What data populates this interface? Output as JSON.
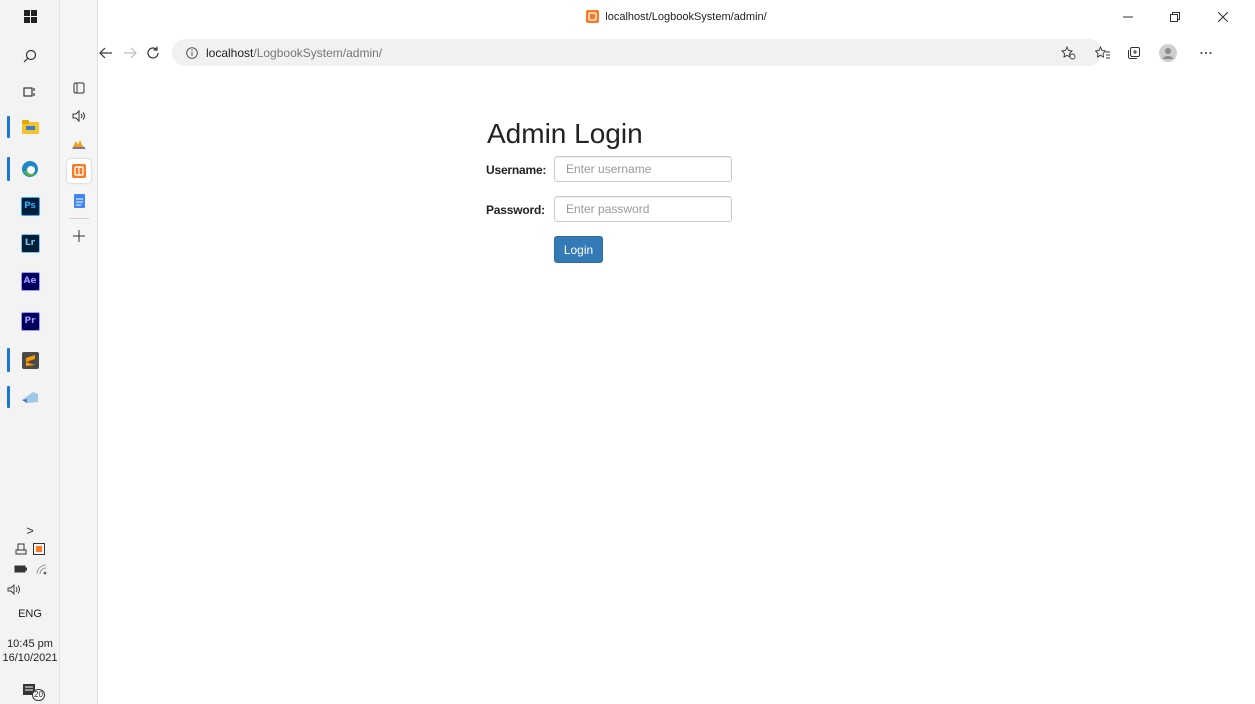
{
  "window": {
    "title": "localhost/LogbookSystem/admin/"
  },
  "address_bar": {
    "info_icon": "info-icon",
    "host": "localhost",
    "path": "/LogbookSystem/admin/"
  },
  "taskbar": {
    "apps": [
      {
        "name": "windows-start",
        "glyph": ""
      },
      {
        "name": "search",
        "glyph": ""
      },
      {
        "name": "task-view",
        "glyph": ""
      },
      {
        "name": "file-explorer",
        "glyph": ""
      },
      {
        "name": "microsoft-edge",
        "glyph": ""
      },
      {
        "name": "photoshop",
        "glyph": "Ps"
      },
      {
        "name": "lightroom",
        "glyph": "Lr"
      },
      {
        "name": "after-effects",
        "glyph": "Ae"
      },
      {
        "name": "premiere-pro",
        "glyph": "Pr"
      },
      {
        "name": "sublime-text",
        "glyph": ""
      },
      {
        "name": "other-app",
        "glyph": ""
      }
    ],
    "tray": {
      "language": "ENG",
      "time": "10:45 pm",
      "date": "16/10/2021",
      "notifications": "20"
    }
  },
  "page": {
    "heading": "Admin Login",
    "username_label": "Username:",
    "username_placeholder": "Enter username",
    "password_label": "Password:",
    "password_placeholder": "Enter password",
    "login_button": "Login"
  },
  "colors": {
    "button_primary": "#337ab7",
    "taskbar_accent": "#1976d2"
  }
}
